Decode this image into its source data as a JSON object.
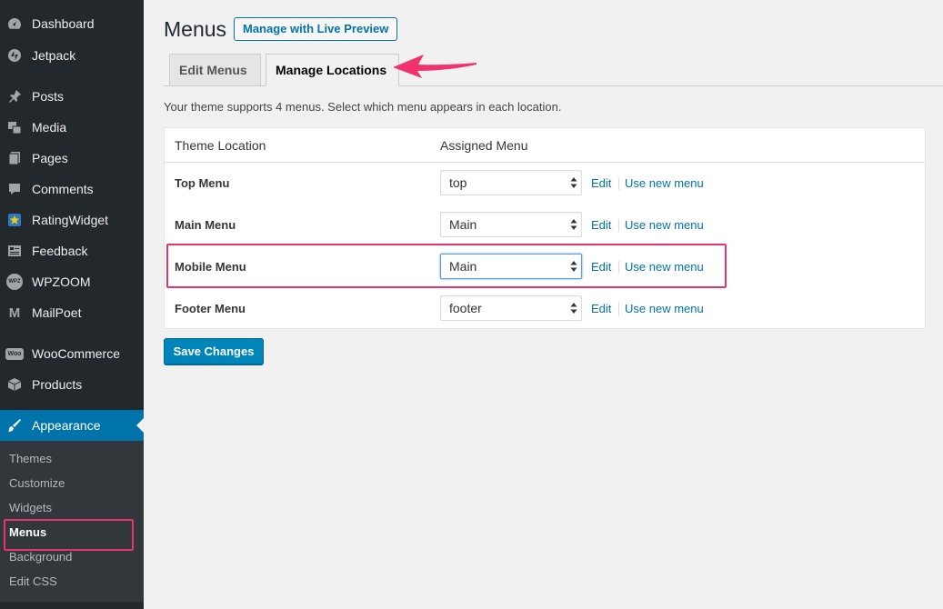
{
  "sidebar": {
    "items": [
      {
        "label": "Dashboard",
        "icon": "dashboard-icon"
      },
      {
        "label": "Jetpack",
        "icon": "jetpack-icon"
      },
      {
        "label": "Posts",
        "icon": "pin-icon"
      },
      {
        "label": "Media",
        "icon": "media-icon"
      },
      {
        "label": "Pages",
        "icon": "pages-icon"
      },
      {
        "label": "Comments",
        "icon": "comment-icon"
      },
      {
        "label": "RatingWidget",
        "icon": "rating-widget-icon"
      },
      {
        "label": "Feedback",
        "icon": "feedback-icon"
      },
      {
        "label": "WPZOOM",
        "icon": "wpzoom-icon",
        "icon_text": "WPZ"
      },
      {
        "label": "MailPoet",
        "icon": "mailpoet-icon",
        "icon_text": "M"
      },
      {
        "label": "WooCommerce",
        "icon": "woocommerce-icon",
        "icon_text": "Woo"
      },
      {
        "label": "Products",
        "icon": "products-icon"
      },
      {
        "label": "Appearance",
        "icon": "brush-icon"
      }
    ],
    "submenu": [
      "Themes",
      "Customize",
      "Widgets",
      "Menus",
      "Background",
      "Edit CSS"
    ],
    "accent": "#0073aa"
  },
  "header": {
    "title": "Menus",
    "live_preview": "Manage with Live Preview"
  },
  "tabs": [
    "Edit Menus",
    "Manage Locations"
  ],
  "description": "Your theme supports 4 menus. Select which menu appears in each location.",
  "table": {
    "headers": [
      "Theme Location",
      "Assigned Menu"
    ],
    "rows": [
      {
        "location": "Top Menu",
        "menu": "top"
      },
      {
        "location": "Main Menu",
        "menu": "Main"
      },
      {
        "location": "Mobile Menu",
        "menu": "Main"
      },
      {
        "location": "Footer Menu",
        "menu": "footer"
      }
    ],
    "edit_label": "Edit",
    "new_menu_label": "Use new menu"
  },
  "save_label": "Save Changes",
  "highlight_color": "#e8336b"
}
